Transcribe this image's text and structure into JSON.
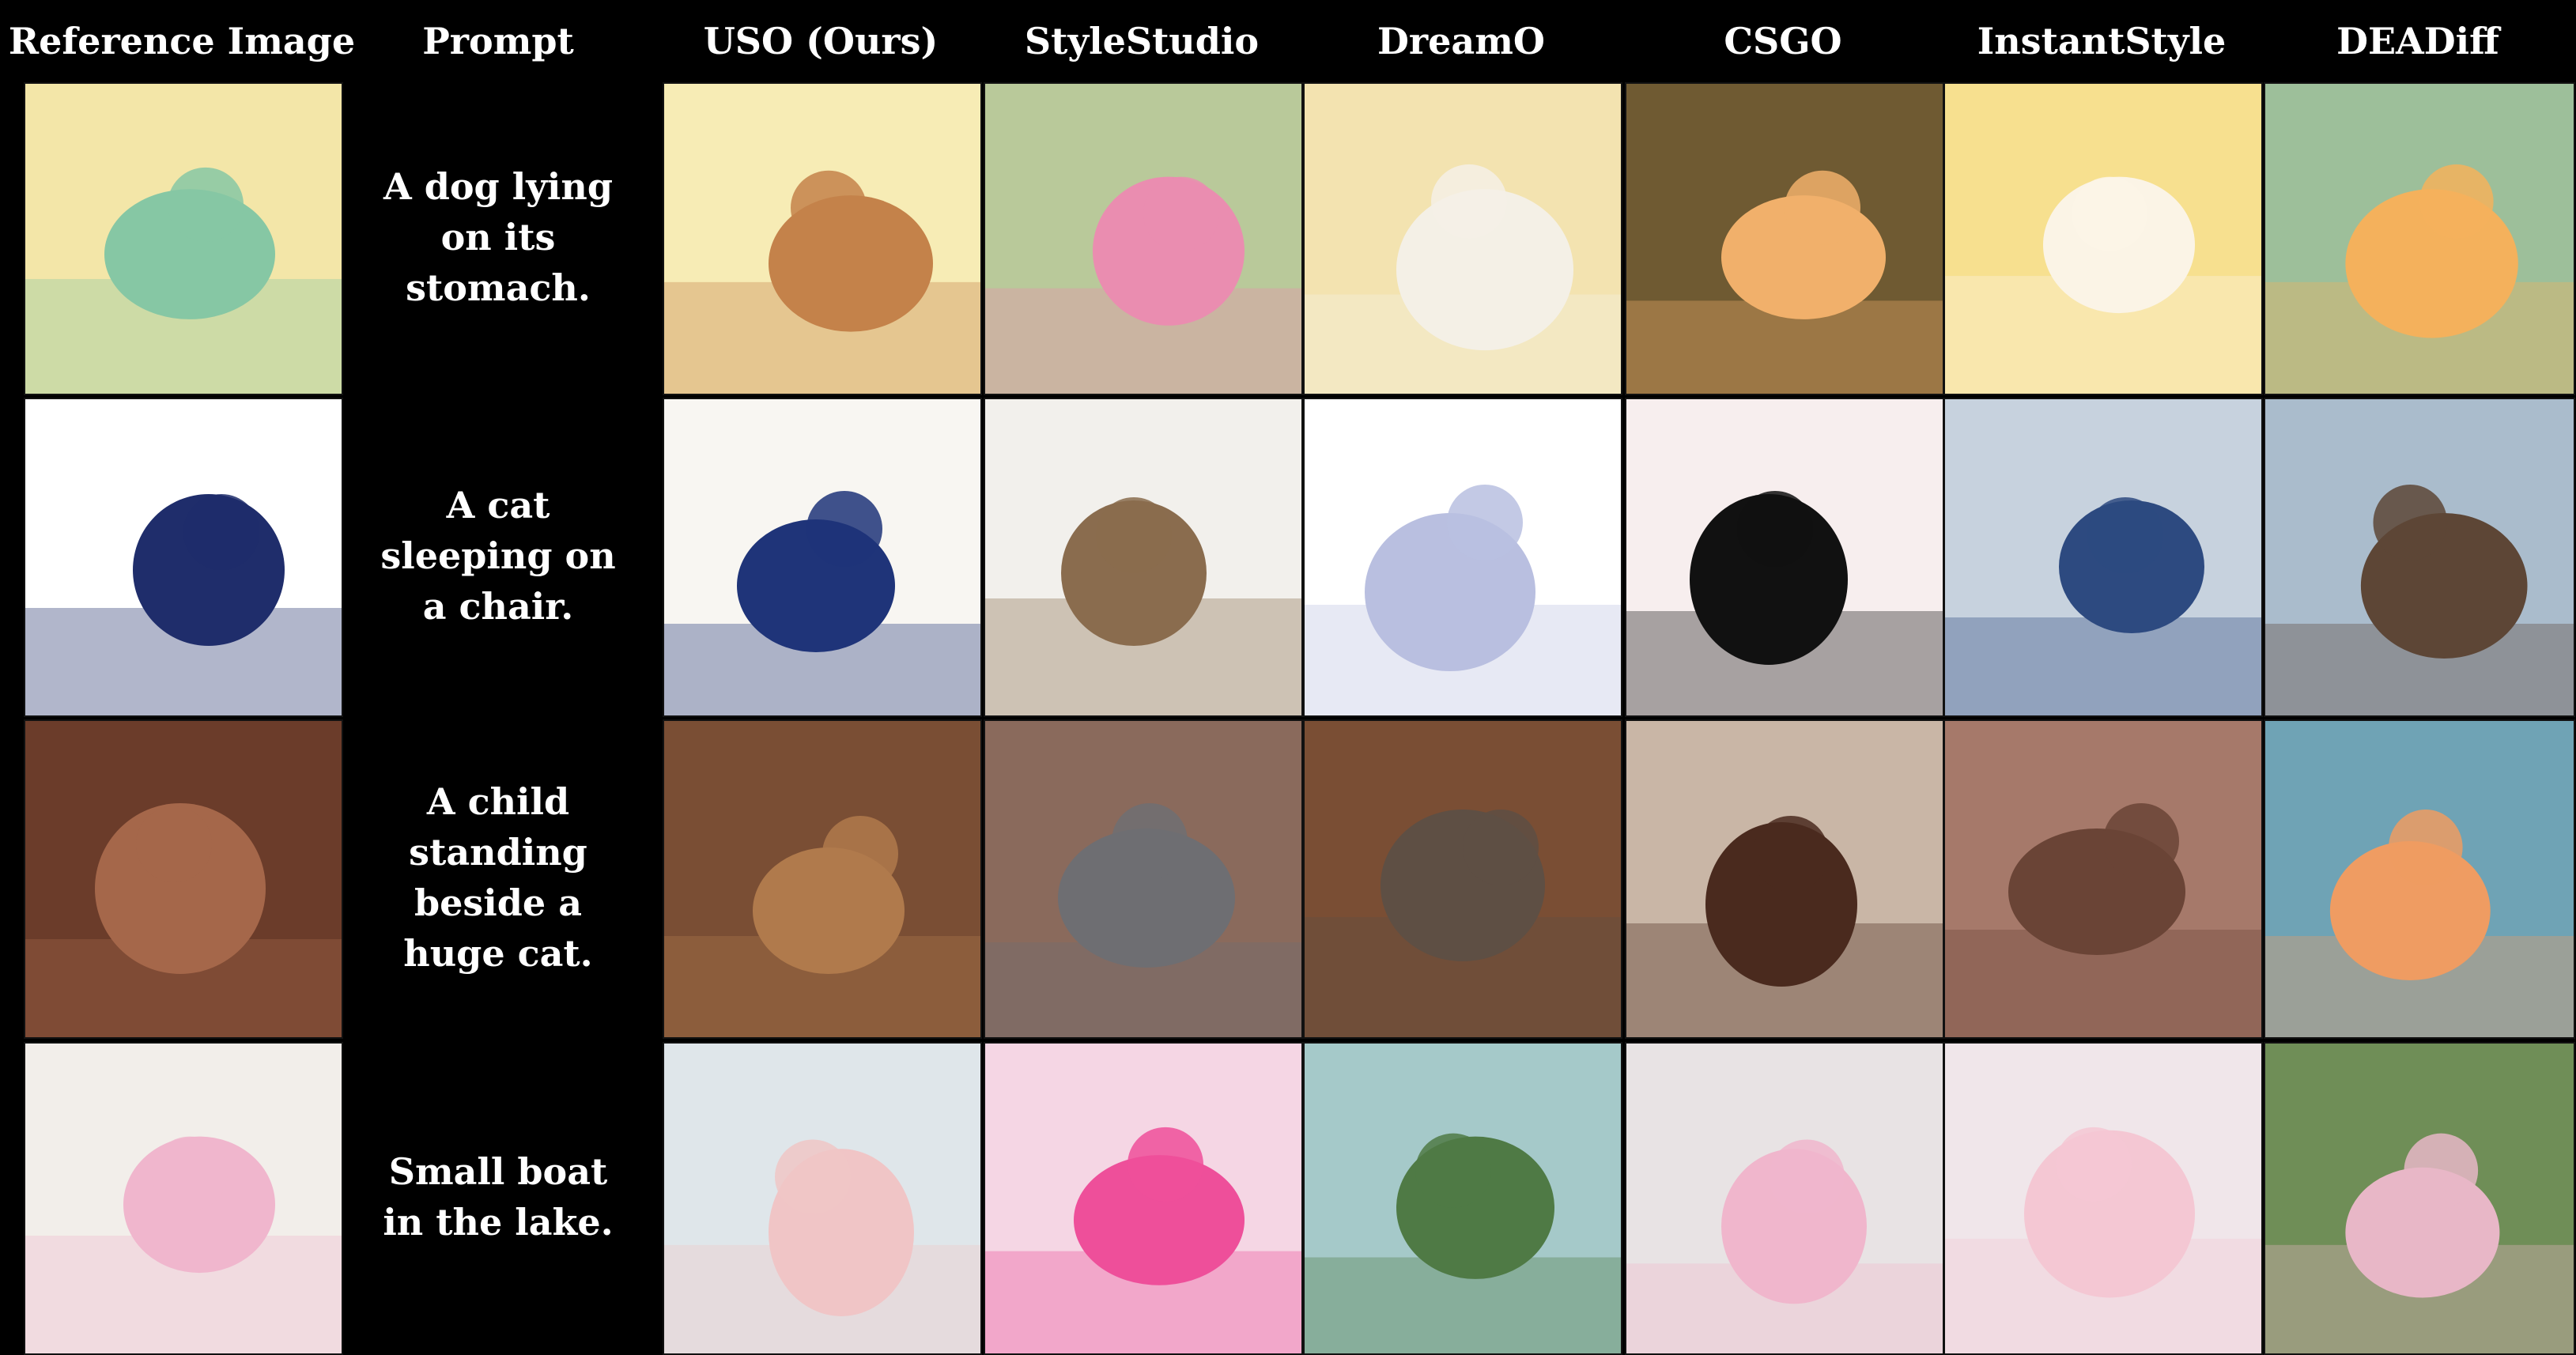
{
  "headers": [
    "Reference Image",
    "Prompt",
    "USO (Ours)",
    "StyleStudio",
    "DreamO",
    "CSGO",
    "InstantStyle",
    "DEADiff"
  ],
  "rows": [
    {
      "prompt": "A dog lying on its stomach.",
      "palette": {
        "ref": [
          "#f3e6a8",
          "#86c7a4"
        ],
        "c": [
          [
            "#f7ecb5",
            "#c4824a"
          ],
          [
            "#b9c99a",
            "#ea8db0"
          ],
          [
            "#f3e3b0",
            "#f4f0e6"
          ],
          [
            "#6f5a32",
            "#f1b06b"
          ],
          [
            "#f7e08f",
            "#fbf4e6"
          ],
          [
            "#9dbf9a",
            "#f4b15c"
          ]
        ]
      }
    },
    {
      "prompt": "A cat sleeping on a chair.",
      "palette": {
        "ref": [
          "#ffffff",
          "#1f2d6b"
        ],
        "c": [
          [
            "#f8f6f2",
            "#1f3479"
          ],
          [
            "#f2f0ec",
            "#8a6c4e"
          ],
          [
            "#ffffff",
            "#b9bfe0"
          ],
          [
            "#f7eeee",
            "#111111"
          ],
          [
            "#c7d2de",
            "#2d4a80"
          ],
          [
            "#aabccc",
            "#5d4636"
          ]
        ]
      }
    },
    {
      "prompt": "A child standing beside a huge cat.",
      "palette": {
        "ref": [
          "#6b3c2a",
          "#a5674a"
        ],
        "c": [
          [
            "#7a4e34",
            "#b07a4c"
          ],
          [
            "#8a6a5c",
            "#6e6e72"
          ],
          [
            "#7a4e34",
            "#5e4f44"
          ],
          [
            "#c9b6a6",
            "#4a2a1e"
          ],
          [
            "#a6796a",
            "#6a4436"
          ],
          [
            "#6fa3b5",
            "#ef9c62"
          ]
        ]
      }
    },
    {
      "prompt": "Small boat in the lake.",
      "palette": {
        "ref": [
          "#f2eeea",
          "#f0b6cd"
        ],
        "c": [
          [
            "#dfe6ea",
            "#f0c5c6"
          ],
          [
            "#f5d6e4",
            "#ee4f9a"
          ],
          [
            "#a5c9c9",
            "#4f7a45"
          ],
          [
            "#e8e3e4",
            "#f0b6cc"
          ],
          [
            "#f0e6ea",
            "#f4c7d3"
          ],
          [
            "#6f8e57",
            "#e8b7c7"
          ]
        ]
      }
    }
  ]
}
